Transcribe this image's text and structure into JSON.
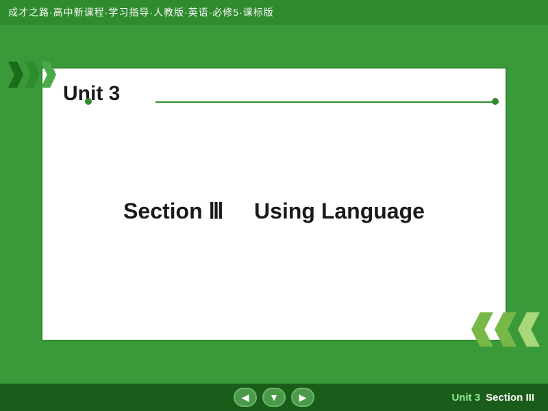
{
  "header": {
    "title": "成才之路·高中新课程·学习指导·人教版·英语·必修5·课标版"
  },
  "card": {
    "unit_label": "Unit 3",
    "section_label": "Section Ⅲ",
    "section_subtitle": "Using Language"
  },
  "footer": {
    "unit_label": "Unit 3",
    "section_label": "Section III",
    "nav_prev": "◀",
    "nav_home": "▼",
    "nav_next": "▶"
  }
}
